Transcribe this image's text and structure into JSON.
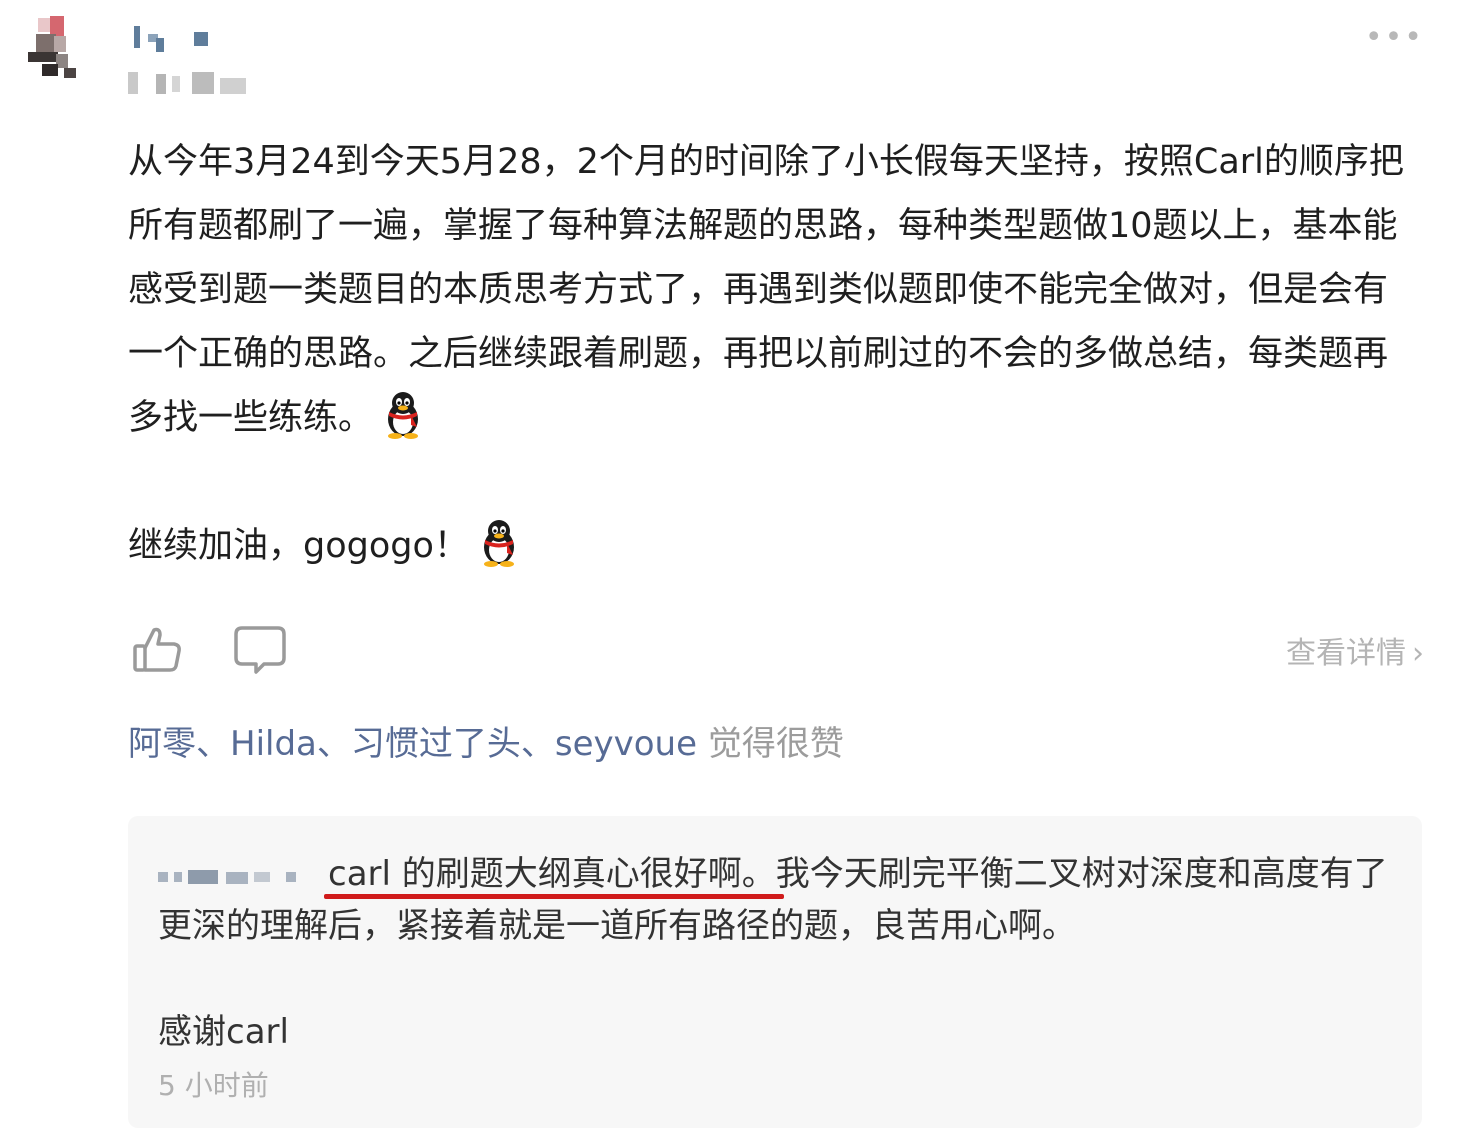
{
  "post": {
    "more_label": "•••",
    "paragraph1": "从今年3月24到今天5月28，2个月的时间除了小长假每天坚持，按照Carl的顺序把所有题都刷了一遍，掌握了每种算法解题的思路，每种类型题做10题以上，基本能感受到题一类题目的本质思考方式了，再遇到类似题即使不能完全做对，但是会有一个正确的思路。之后继续跟着刷题，再把以前刷过的不会的多做总结，每类题再多找一些练练。",
    "paragraph2": "继续加油，gogogo！"
  },
  "actions": {
    "detail_label": "查看详情",
    "chevron": "›"
  },
  "likes": {
    "names": "阿零、Hilda、习惯过了头、seyvoue",
    "suffix": " 觉得很赞"
  },
  "comment": {
    "text": "carl 的刷题大纲真心很好啊。我今天刷完平衡二叉树对深度和高度有了更深的理解后，紧接着就是一道所有路径的题，良苦用心啊。",
    "thanks": "感谢carl",
    "time": "5 小时前"
  },
  "colors": {
    "link": "#576b95",
    "underline": "#d01b1b",
    "comment_bg": "#f7f7f7"
  }
}
